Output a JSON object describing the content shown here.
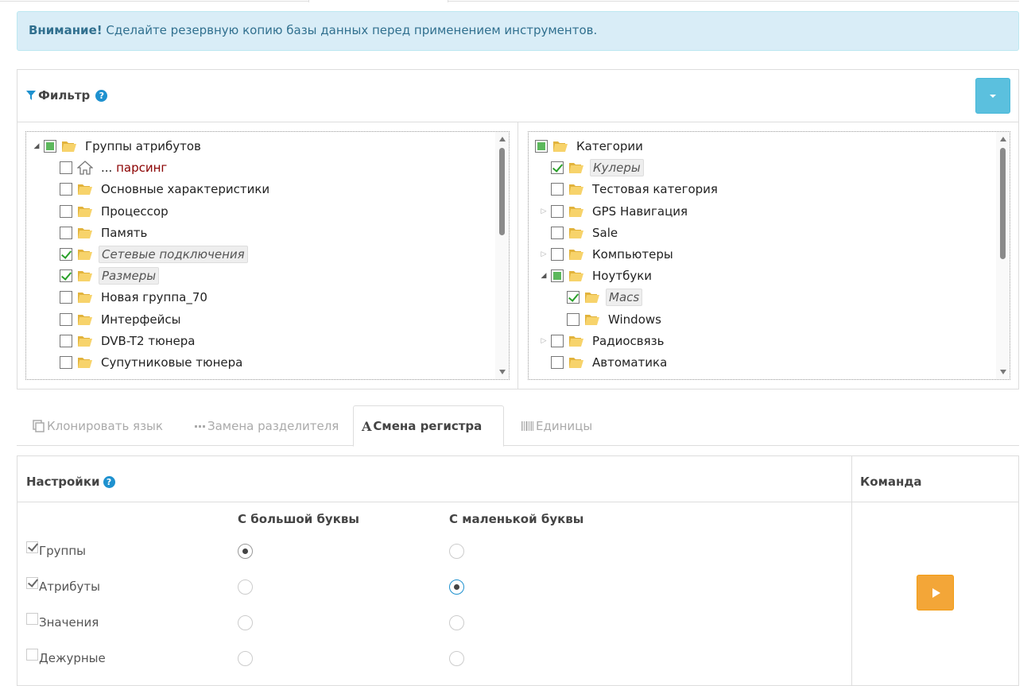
{
  "alert": {
    "strong": "Внимание!",
    "text": " Сделайте резервную копию базы данных перед применением инструментов."
  },
  "filter": {
    "title": "Фильтр",
    "help": "?"
  },
  "left_tree": [
    {
      "label": "Группы атрибутов",
      "state": "partial",
      "arrow": "down",
      "level": 0,
      "icon": "folder"
    },
    {
      "label_prefix": "... ",
      "label": "парсинг",
      "state": "unchecked",
      "level": 1,
      "icon": "home"
    },
    {
      "label": "Основные характеристики",
      "state": "unchecked",
      "level": 1,
      "icon": "folder"
    },
    {
      "label": "Процессор",
      "state": "unchecked",
      "level": 1,
      "icon": "folder"
    },
    {
      "label": "Память",
      "state": "unchecked",
      "level": 1,
      "icon": "folder"
    },
    {
      "label": "Сетевые подключения",
      "state": "checked",
      "level": 1,
      "icon": "folder",
      "selected": true
    },
    {
      "label": "Размеры",
      "state": "checked",
      "level": 1,
      "icon": "folder",
      "selected": true
    },
    {
      "label": "Новая группа_70",
      "state": "unchecked",
      "level": 1,
      "icon": "folder"
    },
    {
      "label": "Интерфейсы",
      "state": "unchecked",
      "level": 1,
      "icon": "folder"
    },
    {
      "label": "DVB-T2 тюнера",
      "state": "unchecked",
      "level": 1,
      "icon": "folder"
    },
    {
      "label": "Супутниковые тюнера",
      "state": "unchecked",
      "level": 1,
      "icon": "folder"
    }
  ],
  "right_tree": [
    {
      "label": "Категории",
      "state": "partial",
      "level": 0,
      "icon": "folder"
    },
    {
      "label": "Кулеры",
      "state": "checked",
      "level": 1,
      "icon": "folder",
      "selected": true
    },
    {
      "label": "Тестовая категория",
      "state": "unchecked",
      "level": 1,
      "icon": "folder"
    },
    {
      "label": "GPS Навигация",
      "state": "unchecked",
      "level": 1,
      "icon": "folder",
      "arrow": "right"
    },
    {
      "label": "Sale",
      "state": "unchecked",
      "level": 1,
      "icon": "folder"
    },
    {
      "label": "Компьютеры",
      "state": "unchecked",
      "level": 1,
      "icon": "folder",
      "arrow": "right"
    },
    {
      "label": "Ноутбуки",
      "state": "partial",
      "level": 1,
      "icon": "folder",
      "arrow": "down"
    },
    {
      "label": "Macs",
      "state": "checked",
      "level": 2,
      "icon": "folder",
      "selected": true
    },
    {
      "label": "Windows",
      "state": "unchecked",
      "level": 2,
      "icon": "folder"
    },
    {
      "label": "Радиосвязь",
      "state": "unchecked",
      "level": 1,
      "icon": "folder",
      "arrow": "right"
    },
    {
      "label": "Автоматика",
      "state": "unchecked",
      "level": 1,
      "icon": "folder"
    }
  ],
  "tabs": [
    {
      "label": "Клонировать язык",
      "icon": "copy-icon",
      "active": false
    },
    {
      "label": "Замена разделителя",
      "icon": "dots-icon",
      "active": false
    },
    {
      "label": "Смена регистра",
      "icon": "font-icon",
      "active": true
    },
    {
      "label": "Единицы",
      "icon": "barcode-icon",
      "active": false
    }
  ],
  "table": {
    "settings_header": "Настройки",
    "command_header": "Команда",
    "col_upper": "С большой буквы",
    "col_lower": "С маленькой буквы",
    "rows": [
      {
        "label": "Группы",
        "checked": true,
        "choice": "upper"
      },
      {
        "label": "Атрибуты",
        "checked": true,
        "choice": "lower"
      },
      {
        "label": "Значения",
        "checked": false,
        "choice": null
      },
      {
        "label": "Дежурные",
        "checked": false,
        "choice": null
      }
    ]
  },
  "colors": {
    "info": "#d9edf7",
    "accent": "#1e91cf",
    "run": "#f3a638",
    "dropdown": "#5bc0de"
  }
}
